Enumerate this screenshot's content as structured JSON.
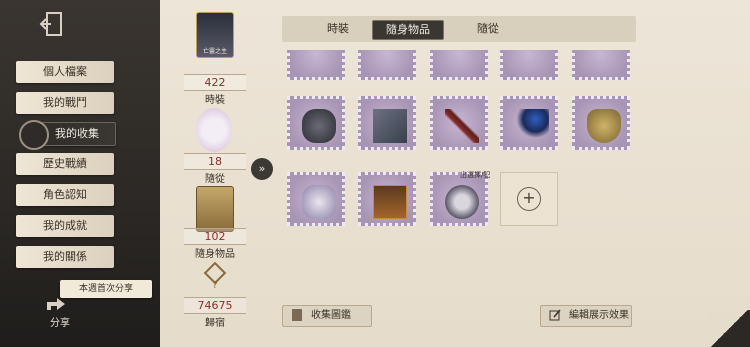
{
  "sidebar": {
    "items": [
      {
        "label": "個人檔案",
        "active": false
      },
      {
        "label": "我的戰鬥",
        "active": false
      },
      {
        "label": "我的收集",
        "active": true
      },
      {
        "label": "歷史戰績",
        "active": false
      },
      {
        "label": "角色認知",
        "active": false
      },
      {
        "label": "我的成就",
        "active": false
      },
      {
        "label": "我的關係",
        "active": false
      }
    ],
    "share_banner": "本週首次分享",
    "share_label": "分享"
  },
  "stats": {
    "card_caption": "亡靈之主",
    "outfits": {
      "count": "422",
      "label": "時裝"
    },
    "pets": {
      "count": "18",
      "label": "隨從"
    },
    "accessories": {
      "count": "102",
      "label": "隨身物品"
    },
    "return": {
      "count": "74675",
      "label": "歸宿"
    }
  },
  "tabs": [
    {
      "label": "時裝",
      "active": false
    },
    {
      "label": "隨身物品",
      "active": true
    },
    {
      "label": "隨從",
      "active": false
    }
  ],
  "grid": {
    "sticker_text": "出選擇/犯"
  },
  "buttons": {
    "collection_label": "收集圖鑑",
    "edit_label": "編輯展示效果"
  },
  "colors": {
    "accent_active": "#3a3733",
    "stamp_purple": "#b6a5c2",
    "count_red": "#8a2e2a",
    "paper": "#ede5d8"
  }
}
